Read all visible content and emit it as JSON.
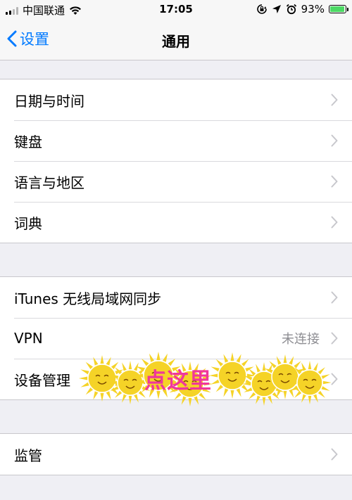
{
  "status_bar": {
    "carrier": "中国联通",
    "time": "17:05",
    "battery": "93%",
    "battery_level": 0.93,
    "icons": [
      "signal-icon",
      "wifi-icon",
      "orientation-lock-icon",
      "location-icon",
      "alarm-icon",
      "battery-icon"
    ]
  },
  "nav": {
    "back_label": "设置",
    "title": "通用"
  },
  "groups": [
    {
      "rows": [
        {
          "label": "日期与时间"
        },
        {
          "label": "键盘"
        },
        {
          "label": "语言与地区"
        },
        {
          "label": "词典"
        }
      ]
    },
    {
      "rows": [
        {
          "label": "iTunes 无线局域网同步"
        },
        {
          "label": "VPN",
          "value": "未连接"
        },
        {
          "label": "设备管理"
        }
      ]
    },
    {
      "rows": [
        {
          "label": "监管"
        }
      ]
    }
  ],
  "overlay": {
    "text": "点这里",
    "text_color": "#f0379b",
    "sun_color": "#f5d327"
  },
  "colors": {
    "accent": "#007aff",
    "background": "#efeff4",
    "battery": "#4cd964",
    "chevron": "#c7c7cc",
    "secondary_text": "#8e8e93"
  }
}
